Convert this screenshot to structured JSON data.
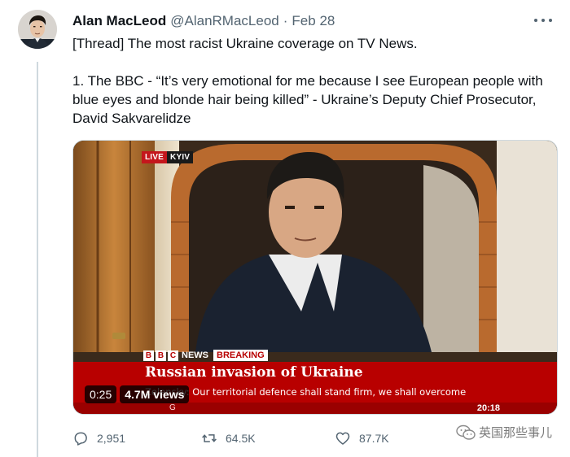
{
  "tweet": {
    "author_name": "Alan MacLeod",
    "handle": "@AlanRMacLeod",
    "separator": "·",
    "date": "Feb 28",
    "text_line1": "[Thread] The most racist Ukraine coverage on TV News.",
    "text_line2": "1. The BBC - “It’s very emotional for me because I see European people with blue eyes and blonde hair being killed” - Ukraine’s Deputy Chief Prosecutor, David Sakvarelidze"
  },
  "video": {
    "live_label": "LIVE",
    "location": "KYIV",
    "bbc_letters": [
      "B",
      "B",
      "C"
    ],
    "news_label": "NEWS",
    "breaking_label": "BREAKING",
    "headline": "Russian invasion of Ukraine",
    "ticker": "Zelensky: Our territorial defence shall stand firm, we shall overcome",
    "ticker_partial": "G",
    "clock": "20:18",
    "elapsed": "0:25",
    "views": "4.7M views"
  },
  "actions": {
    "replies": "2,951",
    "retweets": "64.5K",
    "likes": "87.7K"
  },
  "watermark": {
    "text": "英国那些事儿",
    "icon": "wechat-icon"
  },
  "icons": {
    "reply": "reply-icon",
    "retweet": "retweet-icon",
    "like": "heart-icon",
    "more": "more-icon"
  },
  "colors": {
    "bbc_red": "#b80000",
    "live_red": "#c4161c",
    "text_secondary": "#536471",
    "text_primary": "#0f1419"
  }
}
